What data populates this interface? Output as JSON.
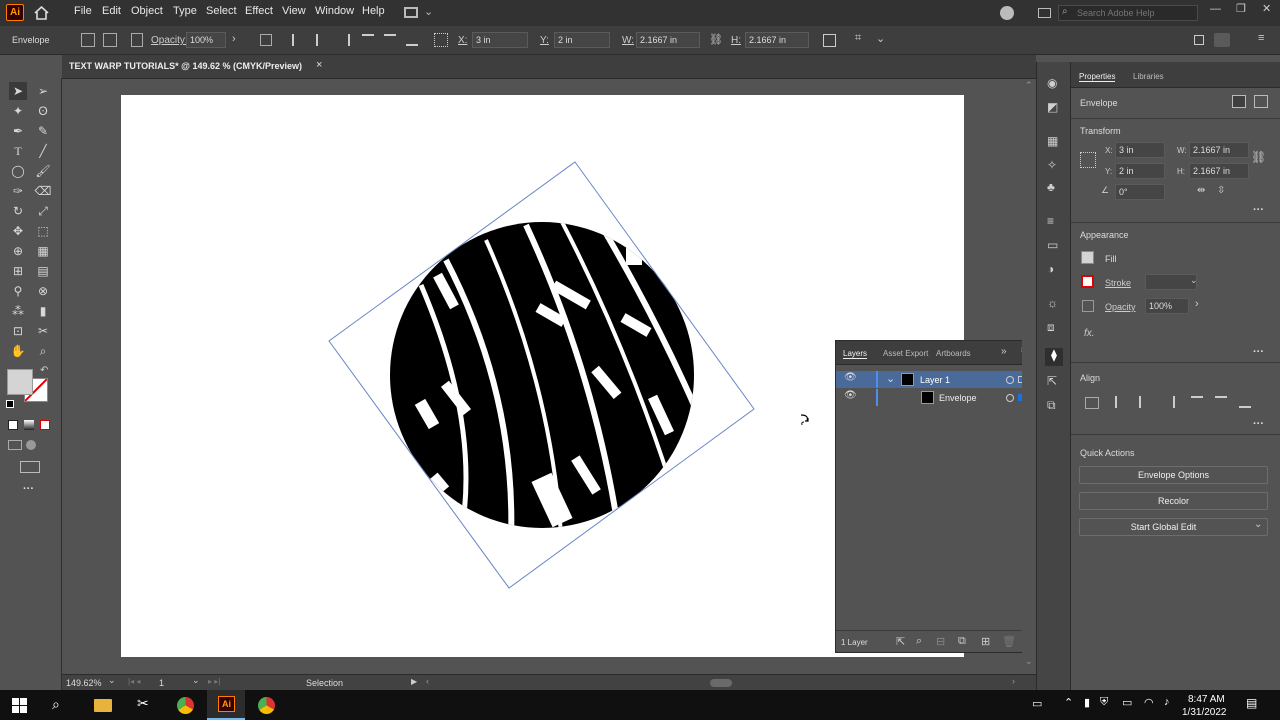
{
  "app": {
    "logo": "Ai",
    "menus": [
      "File",
      "Edit",
      "Object",
      "Type",
      "Select",
      "Effect",
      "View",
      "Window",
      "Help"
    ],
    "search_placeholder": "Search Adobe Help"
  },
  "control": {
    "object_type": "Envelope",
    "opacity_label": "Opacity:",
    "opacity_value": "100%",
    "x_label": "X:",
    "x_value": "3 in",
    "y_label": "Y:",
    "y_value": "2 in",
    "w_label": "W:",
    "w_value": "2.1667 in",
    "h_label": "H:",
    "h_value": "2.1667 in"
  },
  "document": {
    "tab_title": "TEXT WARP TUTORIALS* @ 149.62 % (CMYK/Preview)",
    "close": "×"
  },
  "layers_panel": {
    "tabs": [
      "Layers",
      "Asset Export",
      "Artboards"
    ],
    "rows": [
      {
        "name": "Layer 1"
      },
      {
        "name": "Envelope"
      }
    ],
    "footer": "1 Layer"
  },
  "properties": {
    "tabs": [
      "Properties",
      "Libraries"
    ],
    "selection": "Envelope",
    "transform": {
      "title": "Transform",
      "x_label": "X:",
      "x": "3 in",
      "y_label": "Y:",
      "y": "2 in",
      "w_label": "W:",
      "w": "2.1667 in",
      "h_label": "H:",
      "h": "2.1667 in",
      "angle": "0°"
    },
    "appearance": {
      "title": "Appearance",
      "fill": "Fill",
      "stroke": "Stroke",
      "opacity_label": "Opacity",
      "opacity": "100%",
      "fx": "fx."
    },
    "align": {
      "title": "Align"
    },
    "quick_actions": {
      "title": "Quick Actions",
      "buttons": [
        "Envelope Options",
        "Recolor",
        "Start Global Edit"
      ]
    }
  },
  "status": {
    "zoom": "149.62%",
    "artboard": "1",
    "tool": "Selection"
  },
  "taskbar": {
    "time": "8:47 AM",
    "date": "1/31/2022"
  },
  "colors": {
    "accent": "#1473e6",
    "logo_border": "#ff7c00",
    "chrome_icon": "#4caf50"
  }
}
